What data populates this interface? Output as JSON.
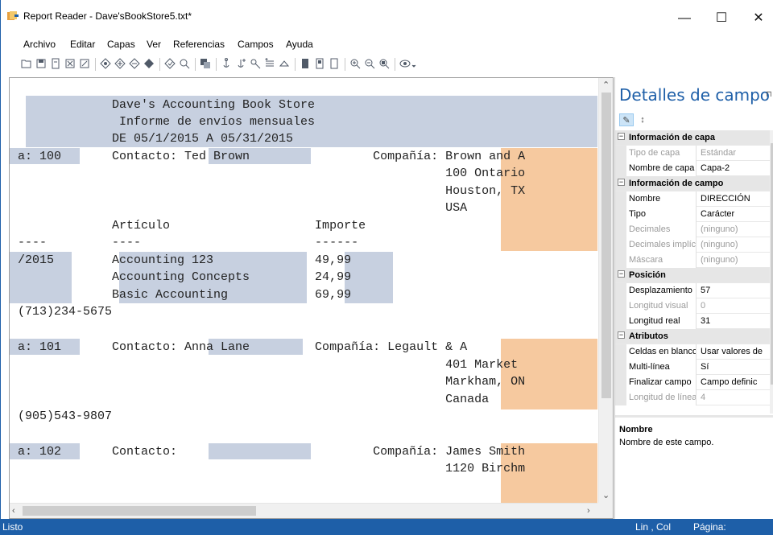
{
  "window": {
    "title": "Report Reader - Dave'sBookStore5.txt*",
    "minimize": "—",
    "maximize": "☐",
    "close": "✕"
  },
  "menu": [
    "Archivo",
    "Editar",
    "Capas",
    "Ver",
    "Referencias",
    "Campos",
    "Ayuda"
  ],
  "toolbar_icons": [
    "open-folder-icon",
    "save-icon",
    "print-icon",
    "close-doc-icon",
    "close-all-icon",
    "layer-icon",
    "layer-add-icon",
    "layer-remove-icon",
    "layer-fill-icon",
    "zoom-layer-icon",
    "find-icon",
    "copy-layer-icon",
    "anchor-icon",
    "anchor-add-icon",
    "field-icon",
    "field-add-icon",
    "eraser-icon",
    "page-icon",
    "page-add-icon",
    "page-copy-icon",
    "zoom-in-icon",
    "zoom-out-icon",
    "zoom-fit-icon",
    "view-icon"
  ],
  "document": {
    "lines": [
      {
        "text": "             Dave's Accounting Book Store"
      },
      {
        "text": "              Informe de envíos mensuales"
      },
      {
        "text": "             DE 05/1/2015 A 05/31/2015"
      },
      {
        "text": "a: 100       Contacto: Ted Brown                 Compañía: Brown and A"
      },
      {
        "text": "                                                           100 Ontario"
      },
      {
        "text": "                                                           Houston, TX"
      },
      {
        "text": "                                                           USA"
      },
      {
        "text": "             Artículo                    Importe"
      },
      {
        "text": "----         ----                        ------"
      },
      {
        "text": "/2015        Accounting 123              49,99"
      },
      {
        "text": "             Accounting Concepts         24,99"
      },
      {
        "text": "             Basic Accounting            69,99"
      },
      {
        "text": "(713)234-5675"
      },
      {
        "text": ""
      },
      {
        "text": "a: 101       Contacto: Anna Lane         Compañía: Legault & A"
      },
      {
        "text": "                                                           401 Market"
      },
      {
        "text": "                                                           Markham, ON"
      },
      {
        "text": "                                                           Canada"
      },
      {
        "text": "(905)543-9807"
      },
      {
        "text": ""
      },
      {
        "text": "a: 102       Contacto:                           Compañía: James Smith"
      },
      {
        "text": "                                                           1120 Birchm"
      }
    ]
  },
  "panel": {
    "title": "Detalles de campo",
    "pin": "⊓",
    "tool_categorized": "✎",
    "tool_sort": "↕",
    "rows": [
      {
        "type": "cat",
        "label": "Información de capa"
      },
      {
        "type": "prop",
        "key": "Tipo de capa",
        "value": "Estándar",
        "disabled": true
      },
      {
        "type": "prop",
        "key": "Nombre de capa",
        "value": "Capa-2",
        "disabled": false
      },
      {
        "type": "cat",
        "label": "Información de campo"
      },
      {
        "type": "prop",
        "key": "Nombre",
        "value": "DIRECCIÓN",
        "disabled": false
      },
      {
        "type": "prop",
        "key": "Tipo",
        "value": "Carácter",
        "disabled": false
      },
      {
        "type": "prop",
        "key": "Decimales",
        "value": "(ninguno)",
        "disabled": true
      },
      {
        "type": "prop",
        "key": "Decimales implícitos",
        "value": "(ninguno)",
        "disabled": true
      },
      {
        "type": "prop",
        "key": "Máscara",
        "value": "(ninguno)",
        "disabled": true
      },
      {
        "type": "cat",
        "label": "Posición"
      },
      {
        "type": "prop",
        "key": "Desplazamiento",
        "value": "57",
        "disabled": false
      },
      {
        "type": "prop",
        "key": "Longitud visual",
        "value": "0",
        "disabled": true
      },
      {
        "type": "prop",
        "key": "Longitud real",
        "value": "31",
        "disabled": false
      },
      {
        "type": "cat",
        "label": "Atributos"
      },
      {
        "type": "prop",
        "key": "Celdas en blanco",
        "value": "Usar valores de",
        "disabled": false
      },
      {
        "type": "prop",
        "key": "Multi-línea",
        "value": "Sí",
        "disabled": false
      },
      {
        "type": "prop",
        "key": "Finalizar campo",
        "value": "Campo definic",
        "disabled": false
      },
      {
        "type": "prop",
        "key": "Longitud de línea",
        "value": "4",
        "disabled": true
      }
    ],
    "description_title": "Nombre",
    "description_text": "Nombre de este campo."
  },
  "status": {
    "left": "Listo",
    "poscol": "Lin , Col",
    "page": "Página:"
  },
  "colors": {
    "accent": "#1e5fa8",
    "highlight_blue": "#c7d0e0",
    "highlight_orange": "#f6c99f"
  }
}
